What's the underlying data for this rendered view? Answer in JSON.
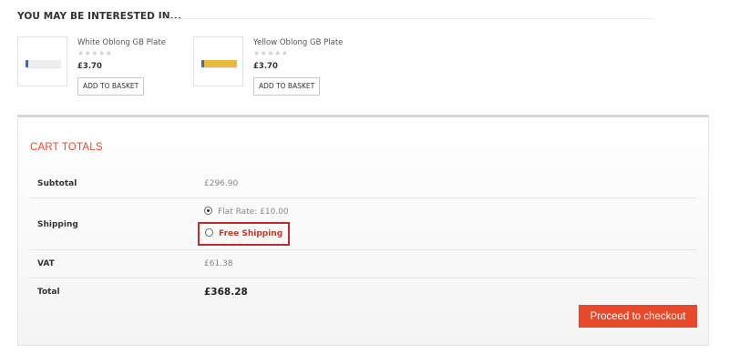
{
  "section": {
    "title": "YOU MAY BE INTERESTED IN..."
  },
  "products": [
    {
      "name": "White Oblong GB Plate",
      "rating_stars": "★★★★★",
      "rating_value": 0,
      "price": "£3.70",
      "button_label": "ADD TO BASKET",
      "color": "#eeeeee"
    },
    {
      "name": "Yellow Oblong GB Plate",
      "rating_stars": "★★★★★",
      "rating_value": 0,
      "price": "£3.70",
      "button_label": "ADD TO BASKET",
      "color": "#e7b93c"
    }
  ],
  "cart_totals": {
    "title": "CART TOTALS",
    "subtotal": {
      "label": "Subtotal",
      "value": "£296.90"
    },
    "shipping": {
      "label": "Shipping",
      "options": [
        {
          "label": "Flat Rate: £10.00",
          "selected": true
        },
        {
          "label": "Free Shipping",
          "selected": false
        }
      ]
    },
    "vat": {
      "label": "VAT",
      "value": "£61.38"
    },
    "total": {
      "label": "Total",
      "value": "£368.28"
    },
    "checkout_label": "Proceed to checkout"
  },
  "colors": {
    "accent": "#e8492a",
    "highlight_border": "#c42a2a"
  }
}
